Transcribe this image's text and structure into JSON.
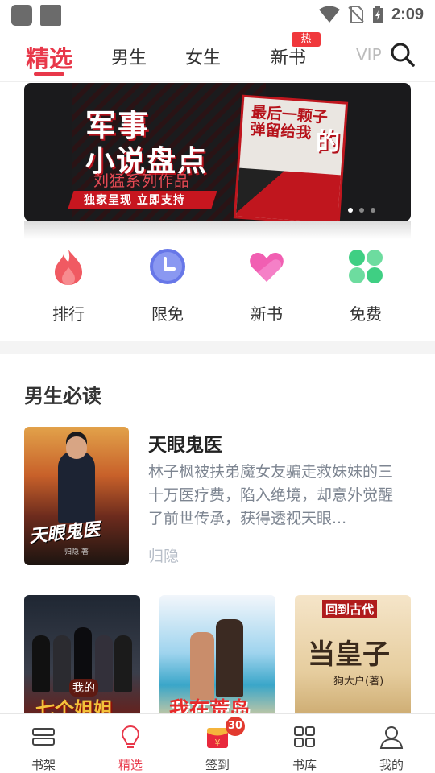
{
  "status_bar": {
    "time": "2:09"
  },
  "top_tabs": {
    "items": [
      "精选",
      "男生",
      "女生",
      "新书",
      "VIP"
    ],
    "active": "精选",
    "hot_badge": "热"
  },
  "banner": {
    "title_line1": "军事",
    "title_line2": "小说盘点",
    "subtitle": "刘猛系列作品",
    "tag": "独家呈现  立即支持",
    "book_text": "最后一颗子弹留给我",
    "book_suffix": "的",
    "page_count": 3,
    "current_page": 1
  },
  "quick_entries": [
    {
      "label": "排行",
      "icon": "flame-icon",
      "color": "#f05a62"
    },
    {
      "label": "限免",
      "icon": "clock-icon",
      "color": "#6777e8"
    },
    {
      "label": "新书",
      "icon": "heart-icon",
      "color": "#f15fb2"
    },
    {
      "label": "免费",
      "icon": "clover-icon",
      "color": "#3fcf83"
    }
  ],
  "section": {
    "title": "男生必读",
    "featured": {
      "cover_title": "天眼鬼医",
      "cover_author": "归隐 著",
      "title": "天眼鬼医",
      "description": "林子枫被扶弟魔女友骗走救妹妹的三十万医疗费，陷入绝境，却意外觉醒了前世传承，获得透视天眼...",
      "author": "归隐"
    },
    "books": [
      {
        "cover_text": "七个姐姐",
        "cover_small": "我的"
      },
      {
        "cover_text": "我在荒岛"
      },
      {
        "cover_top": "回到古代",
        "cover_text": "当皇子",
        "cover_author": "狗大户(著)"
      }
    ]
  },
  "bottom_nav": {
    "items": [
      {
        "label": "书架",
        "icon": "bookshelf-icon"
      },
      {
        "label": "精选",
        "icon": "lightbulb-icon"
      },
      {
        "label": "签到",
        "icon": "redpacket-icon"
      },
      {
        "label": "书库",
        "icon": "grid-icon"
      },
      {
        "label": "我的",
        "icon": "user-icon"
      }
    ],
    "active": "精选",
    "checkin_badge": "30"
  },
  "colors": {
    "accent": "#e8384a",
    "text": "#333333",
    "muted": "#7d8591"
  }
}
